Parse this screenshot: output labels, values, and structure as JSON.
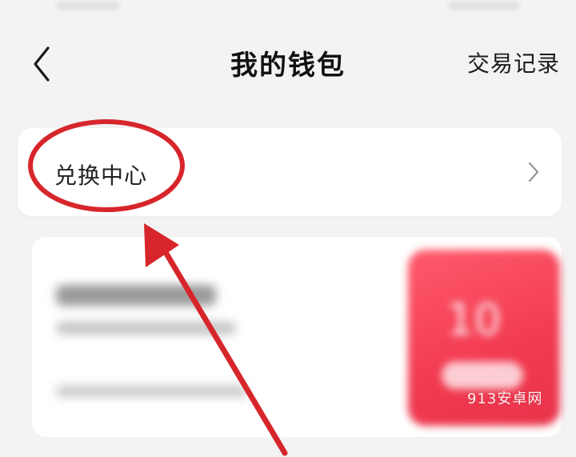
{
  "header": {
    "title": "我的钱包",
    "transactions_link": "交易记录"
  },
  "exchange": {
    "label": "兑换中心"
  },
  "coupon": {
    "amount_blurred": "10"
  },
  "watermark": "913安卓网",
  "icons": {
    "back": "chevron-left-icon",
    "exchange_arrow": "chevron-right-icon"
  },
  "colors": {
    "annotation": "#d7262b",
    "coupon_badge": "#f23a50",
    "background": "#f3f3f4"
  }
}
